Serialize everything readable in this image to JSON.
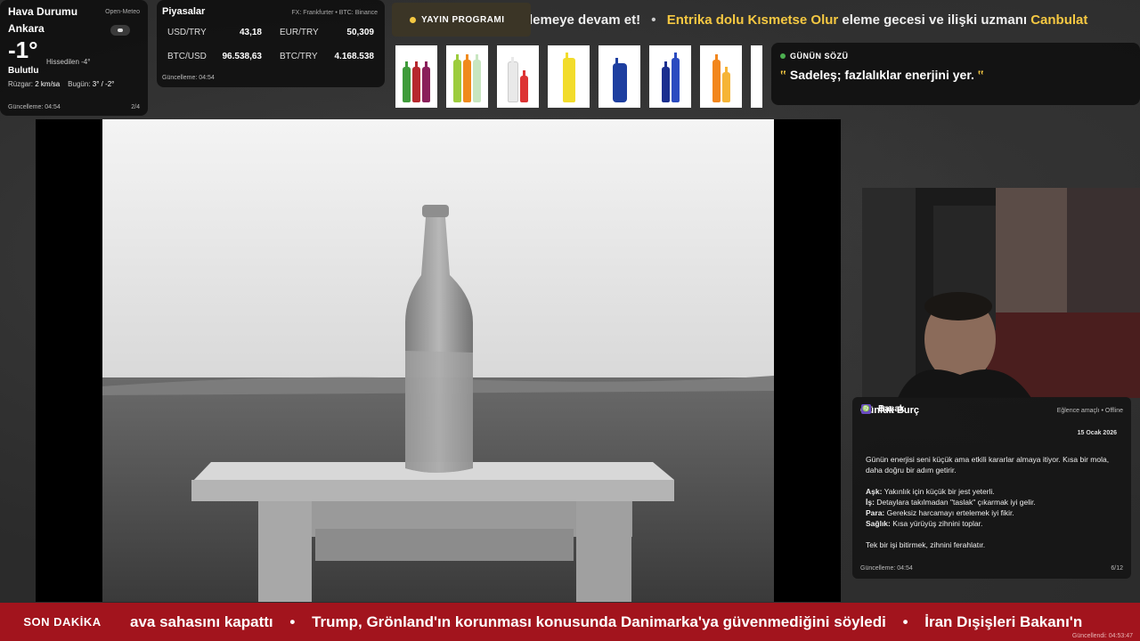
{
  "weather": {
    "title": "Hava Durumu",
    "source": "Open-Meteo",
    "city": "Ankara",
    "temperature": "-1°",
    "feels_like": "Hissedilen -4°",
    "condition": "Bulutlu",
    "wind_label": "Rüzgar:",
    "wind_value": "2 km/sa",
    "today_label": "Bugün:",
    "today_value": "3° / -2°",
    "updated": "Güncelleme: 04:54",
    "page": "2/4"
  },
  "markets": {
    "title": "Piyasalar",
    "source": "FX: Frankfurter • BTC: Binance",
    "items": [
      {
        "label": "USD/TRY",
        "value": "43,18"
      },
      {
        "label": "EUR/TRY",
        "value": "50,309"
      },
      {
        "label": "BTC/USD",
        "value": "96.538,63"
      },
      {
        "label": "BTC/TRY",
        "value": "4.168.538"
      }
    ],
    "updated": "Güncelleme: 04:54"
  },
  "program_button": "YAYIN PROGRAMI",
  "top_ticker": {
    "part1": "lemeye devam et!",
    "highlight1": "Entrika dolu Kısmetse Olur",
    "part2": "eleme gecesi ve ilişki uzmanı",
    "highlight2": "Canbulat"
  },
  "quote": {
    "title": "GÜNÜN SÖZÜ",
    "open_mark": "‟",
    "text": "Sadeleş; fazlalıklar enerjini yer.",
    "close_mark": "‟"
  },
  "horoscope": {
    "title": "Günlük Burç",
    "tag": "Eğlence amaçlı • Offline",
    "sign": "Başak",
    "sign_icon": "♍",
    "date": "15 Ocak 2026",
    "intro": "Günün enerjisi seni küçük ama etkili kararlar almaya itiyor. Kısa bir mola, daha doğru bir adım getirir.",
    "love_label": "Aşk:",
    "love": "Yakınlık için küçük bir jest yeterli.",
    "work_label": "İş:",
    "work": "Detaylara takılmadan \"taslak\" çıkarmak iyi gelir.",
    "money_label": "Para:",
    "money": "Gereksiz harcamayı ertelemek iyi fikir.",
    "health_label": "Sağlık:",
    "health": "Kısa yürüyüş zihnini toplar.",
    "closing": "Tek bir işi bitirmek, zihnini ferahlatır.",
    "updated": "Güncelleme: 04:54",
    "page": "6/12"
  },
  "news": {
    "label": "SON DAKİKA",
    "item1": "ava sahasını kapattı",
    "item2": "Trump, Grönland'ın korunması konusunda Danimarka'ya güvenmediğini söyledi",
    "item3": "İran Dışişleri Bakanı'n",
    "separator": "•",
    "updated": "Güncellendi: 04:53:47"
  },
  "colors": {
    "accent": "#f5c842",
    "news_bar": "#a2141d",
    "live_dot": "#4caf50"
  }
}
